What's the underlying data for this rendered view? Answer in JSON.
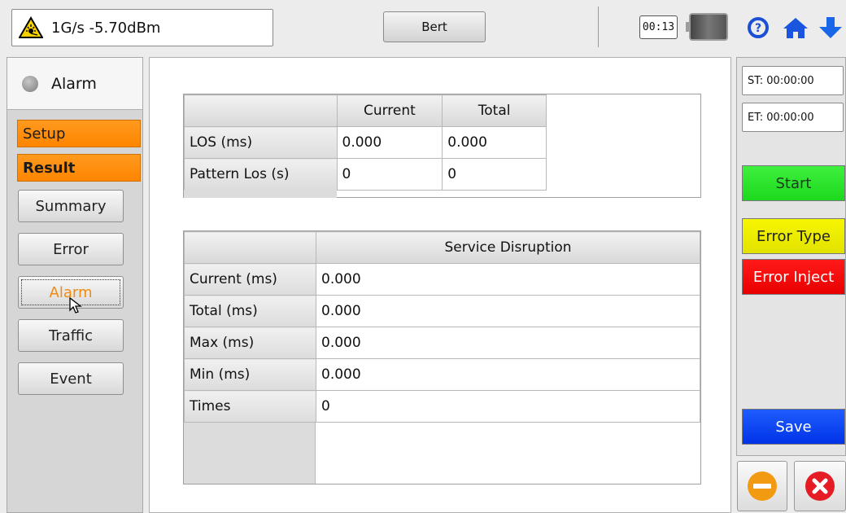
{
  "topbar": {
    "status_text": "1G/s -5.70dBm",
    "mode_button": "Bert",
    "timer": "00:13",
    "icons": [
      "laser-warning-icon",
      "battery-icon",
      "help-icon",
      "home-icon",
      "down-arrow-icon"
    ]
  },
  "sidebar": {
    "alarm_label": "Alarm",
    "setup_label": "Setup",
    "result_label": "Result",
    "items": [
      {
        "label": "Summary"
      },
      {
        "label": "Error"
      },
      {
        "label": "Alarm"
      },
      {
        "label": "Traffic"
      },
      {
        "label": "Event"
      }
    ],
    "active_item": "Alarm"
  },
  "los_table": {
    "headers": [
      "",
      "Current",
      "Total"
    ],
    "rows": [
      {
        "label": "LOS (ms)",
        "current": "0.000",
        "total": "0.000"
      },
      {
        "label": "Pattern Los (s)",
        "current": "0",
        "total": "0"
      }
    ]
  },
  "disruption_table": {
    "headers": [
      "",
      "Service Disruption"
    ],
    "rows": [
      {
        "label": "Current (ms)",
        "value": "0.000"
      },
      {
        "label": "Total (ms)",
        "value": "0.000"
      },
      {
        "label": "Max (ms)",
        "value": "0.000"
      },
      {
        "label": "Min (ms)",
        "value": "0.000"
      },
      {
        "label": "Times",
        "value": "0"
      }
    ]
  },
  "right_panel": {
    "start_time": "ST: 00:00:00",
    "end_time": "ET: 00:00:00",
    "start_button": "Start",
    "error_type_button": "Error Type",
    "error_inject_button": "Error Inject",
    "save_button": "Save"
  },
  "colors": {
    "accent_orange": "#ff8c00",
    "start_green": "#22dd22",
    "error_type_yellow": "#eeee00",
    "error_inject_red": "#ee0000",
    "save_blue": "#0040f0"
  }
}
